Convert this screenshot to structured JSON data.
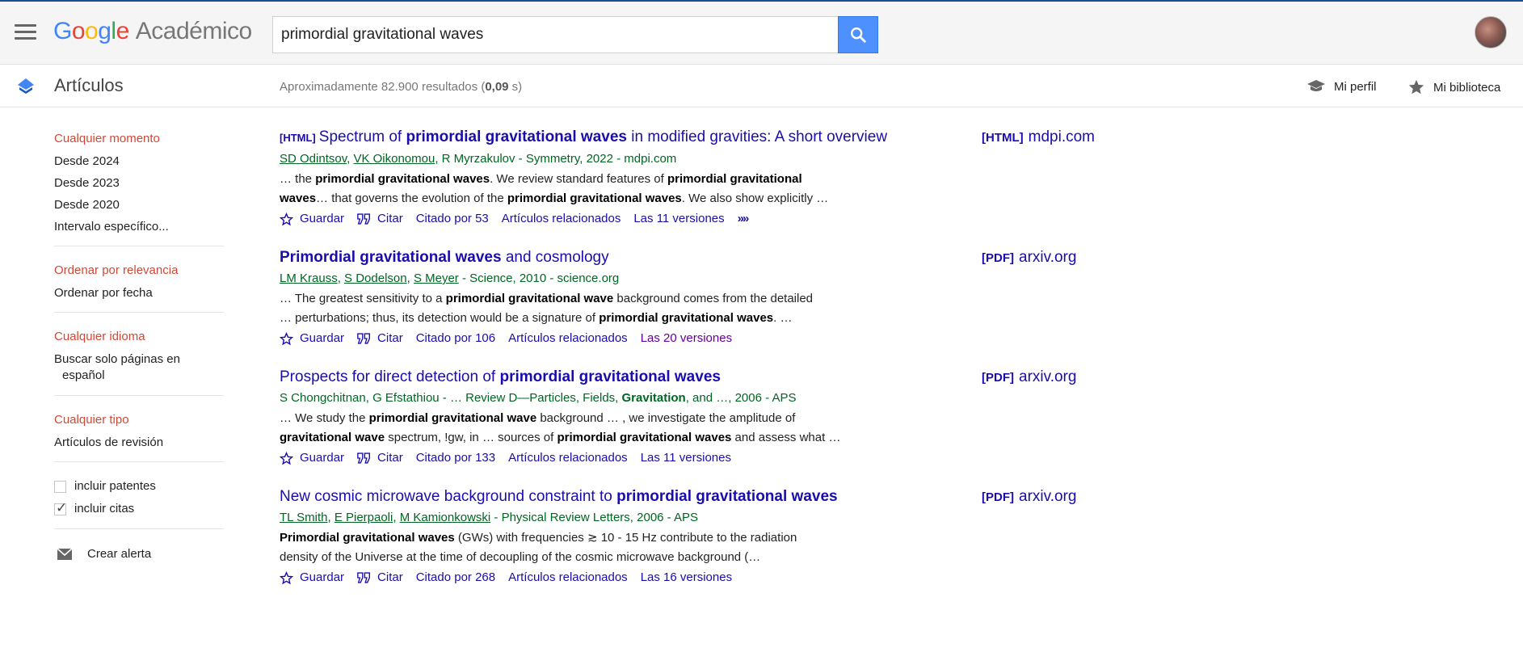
{
  "header": {
    "logo_google": [
      "G",
      "o",
      "o",
      "g",
      "l",
      "e"
    ],
    "logo_product": "Académico",
    "search_value": "primordial gravitational waves"
  },
  "subheader": {
    "title": "Artículos",
    "count_prefix": "Aproximadamente 82.900 resultados (",
    "count_time": "0,09",
    "count_suffix": " s)",
    "profile": "Mi perfil",
    "library": "Mi biblioteca"
  },
  "sidebar": {
    "time": {
      "heading": "Cualquier momento",
      "items": [
        "Desde 2024",
        "Desde 2023",
        "Desde 2020",
        "Intervalo específico..."
      ]
    },
    "sort": {
      "heading": "Ordenar por relevancia",
      "items": [
        "Ordenar por fecha"
      ]
    },
    "lang": {
      "heading": "Cualquier idioma",
      "line1": "Buscar solo páginas en",
      "line2": "español"
    },
    "type": {
      "heading": "Cualquier tipo",
      "items": [
        "Artículos de revisión"
      ]
    },
    "checks": [
      {
        "label": "incluir patentes",
        "checked": false
      },
      {
        "label": "incluir citas",
        "checked": true
      }
    ],
    "alert": "Crear alerta"
  },
  "results": [
    {
      "tag": "[HTML]",
      "title_parts": [
        {
          "t": "Spectrum of ",
          "b": false
        },
        {
          "t": "primordial gravitational waves",
          "b": true
        },
        {
          "t": " in modified gravities: A short overview",
          "b": false
        }
      ],
      "authors": [
        {
          "t": "SD Odintsov",
          "link": true
        },
        {
          "t": ", ",
          "link": false
        },
        {
          "t": "VK Oikonomou",
          "link": true
        },
        {
          "t": ", R Myrzakulov - Symmetry, 2022 - mdpi.com",
          "link": false
        }
      ],
      "snippet": [
        [
          {
            "t": "… the ",
            "b": false
          },
          {
            "t": "primordial gravitational waves",
            "b": true
          },
          {
            "t": ". We review standard features of ",
            "b": false
          },
          {
            "t": "primordial gravitational",
            "b": true
          }
        ],
        [
          {
            "t": "waves",
            "b": true
          },
          {
            "t": "… that governs the evolution of the ",
            "b": false
          },
          {
            "t": "primordial gravitational waves",
            "b": true
          },
          {
            "t": ". We also show explicitly …",
            "b": false
          }
        ]
      ],
      "save": "Guardar",
      "cite": "Citar",
      "cited_by": "Citado por 53",
      "related": "Artículos relacionados",
      "versions": "Las 11 versiones",
      "more": "»",
      "side_tag": "[HTML]",
      "side_site": "mdpi.com"
    },
    {
      "tag": "",
      "title_parts": [
        {
          "t": "Primordial gravitational waves",
          "b": true
        },
        {
          "t": " and cosmology",
          "b": false
        }
      ],
      "authors": [
        {
          "t": "LM Krauss",
          "link": true
        },
        {
          "t": ", ",
          "link": false
        },
        {
          "t": "S Dodelson",
          "link": true
        },
        {
          "t": ", ",
          "link": false
        },
        {
          "t": "S Meyer",
          "link": true
        },
        {
          "t": " - Science, 2010 - science.org",
          "link": false
        }
      ],
      "snippet": [
        [
          {
            "t": "… The greatest sensitivity to a ",
            "b": false
          },
          {
            "t": "primordial gravitational wave",
            "b": true
          },
          {
            "t": " background comes from the detailed",
            "b": false
          }
        ],
        [
          {
            "t": "… perturbations; thus, its detection would be a signature of ",
            "b": false
          },
          {
            "t": "primordial gravitational waves",
            "b": true
          },
          {
            "t": ". …",
            "b": false
          }
        ]
      ],
      "save": "Guardar",
      "cite": "Citar",
      "cited_by": "Citado por 106",
      "related": "Artículos relacionados",
      "versions": "Las 20 versiones",
      "more": "",
      "side_tag": "[PDF]",
      "side_site": "arxiv.org"
    },
    {
      "tag": "",
      "title_parts": [
        {
          "t": "Prospects for direct detection of ",
          "b": false
        },
        {
          "t": "primordial gravitational waves",
          "b": true
        }
      ],
      "authors": [
        {
          "t": "S Chongchitnan, G Efstathiou - … Review D—Particles, Fields, ",
          "link": false
        },
        {
          "t": "Gravitation",
          "link": false,
          "bold": true
        },
        {
          "t": ", and …, 2006 - APS",
          "link": false
        }
      ],
      "snippet": [
        [
          {
            "t": "… We study the ",
            "b": false
          },
          {
            "t": "primordial gravitational wave",
            "b": true
          },
          {
            "t": " background … , we investigate the amplitude of",
            "b": false
          }
        ],
        [
          {
            "t": "gravitational wave",
            "b": true
          },
          {
            "t": " spectrum, !gw, in … sources of ",
            "b": false
          },
          {
            "t": "primordial gravitational waves",
            "b": true
          },
          {
            "t": " and assess what …",
            "b": false
          }
        ]
      ],
      "save": "Guardar",
      "cite": "Citar",
      "cited_by": "Citado por 133",
      "related": "Artículos relacionados",
      "versions": "Las 11 versiones",
      "more": "",
      "side_tag": "[PDF]",
      "side_site": "arxiv.org"
    },
    {
      "tag": "",
      "title_parts": [
        {
          "t": "New cosmic microwave background constraint to ",
          "b": false
        },
        {
          "t": "primordial gravitational waves",
          "b": true
        }
      ],
      "authors": [
        {
          "t": "TL Smith",
          "link": true
        },
        {
          "t": ", ",
          "link": false
        },
        {
          "t": "E Pierpaoli",
          "link": true
        },
        {
          "t": ", ",
          "link": false
        },
        {
          "t": "M Kamionkowski",
          "link": true
        },
        {
          "t": " - Physical Review Letters, 2006 - APS",
          "link": false
        }
      ],
      "snippet": [
        [
          {
            "t": "Primordial gravitational waves",
            "b": true
          },
          {
            "t": " (GWs) with frequencies ≳ 10 - 15 Hz contribute to the radiation",
            "b": false
          }
        ],
        [
          {
            "t": "density of the Universe at the time of decoupling of the cosmic microwave background (…",
            "b": false
          }
        ]
      ],
      "save": "Guardar",
      "cite": "Citar",
      "cited_by": "Citado por 268",
      "related": "Artículos relacionados",
      "versions": "Las 16 versiones",
      "more": "",
      "side_tag": "[PDF]",
      "side_site": "arxiv.org"
    }
  ],
  "colors": {
    "link": "#1a0dab",
    "visited": "#660099",
    "green": "#006621",
    "red_heading": "#d14836",
    "search_blue": "#4d90fe"
  },
  "icons": {
    "menu": "hamburger-menu-icon",
    "search": "magnifier-icon",
    "articles": "blue-chevron-icon",
    "profile": "mortarboard-icon",
    "library": "star-icon",
    "save": "star-outline-icon",
    "cite": "quote-icon",
    "alert": "envelope-icon"
  }
}
